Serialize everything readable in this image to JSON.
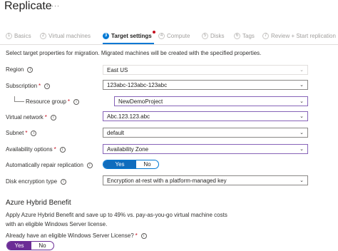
{
  "header": {
    "title": "Replicate",
    "more": "···"
  },
  "steps": [
    {
      "num": "1",
      "label": "Basics"
    },
    {
      "num": "2",
      "label": "Virtual machines"
    },
    {
      "num": "3",
      "label": "Target settings"
    },
    {
      "num": "4",
      "label": "Compute"
    },
    {
      "num": "5",
      "label": "Disks"
    },
    {
      "num": "6",
      "label": "Tags"
    },
    {
      "num": "7",
      "label": "Review + Start replication"
    }
  ],
  "description": "Select target properties for migration. Migrated machines will be created with the specified properties.",
  "fields": {
    "region": {
      "label": "Region",
      "value": "East US"
    },
    "subscription": {
      "label": "Subscription",
      "value": "123abc-123abc-123abc"
    },
    "resource_group": {
      "label": "Resource group",
      "value": "NewDemoProject"
    },
    "virtual_network": {
      "label": "Virtual network",
      "value": "Abc.123.123.abc"
    },
    "subnet": {
      "label": "Subnet",
      "value": "default"
    },
    "availability": {
      "label": "Availability options",
      "value": "Availability Zone"
    },
    "auto_repair": {
      "label": "Automatically repair replication",
      "on": "Yes",
      "off": "No",
      "selected": "Yes"
    },
    "disk_encryption": {
      "label": "Disk encryption type",
      "value": "Encryption at-rest with a platform-managed key"
    }
  },
  "hybrid": {
    "title": "Azure Hybrid Benefit",
    "text": "Apply Azure Hybrid Benefit and save up to 49% vs. pay-as-you-go virtual machine costs with an eligible Windows Server license.",
    "question": "Already have an eligible Windows Server License?",
    "on": "Yes",
    "off": "No",
    "selected": "Yes"
  },
  "icons": {
    "info": "info-icon",
    "chevron": "chevron-down-icon"
  },
  "colors": {
    "accent": "#0078d4",
    "required": "#c50f1f",
    "focus": "#8764b8",
    "toggle_violet": "#6b2d96"
  }
}
